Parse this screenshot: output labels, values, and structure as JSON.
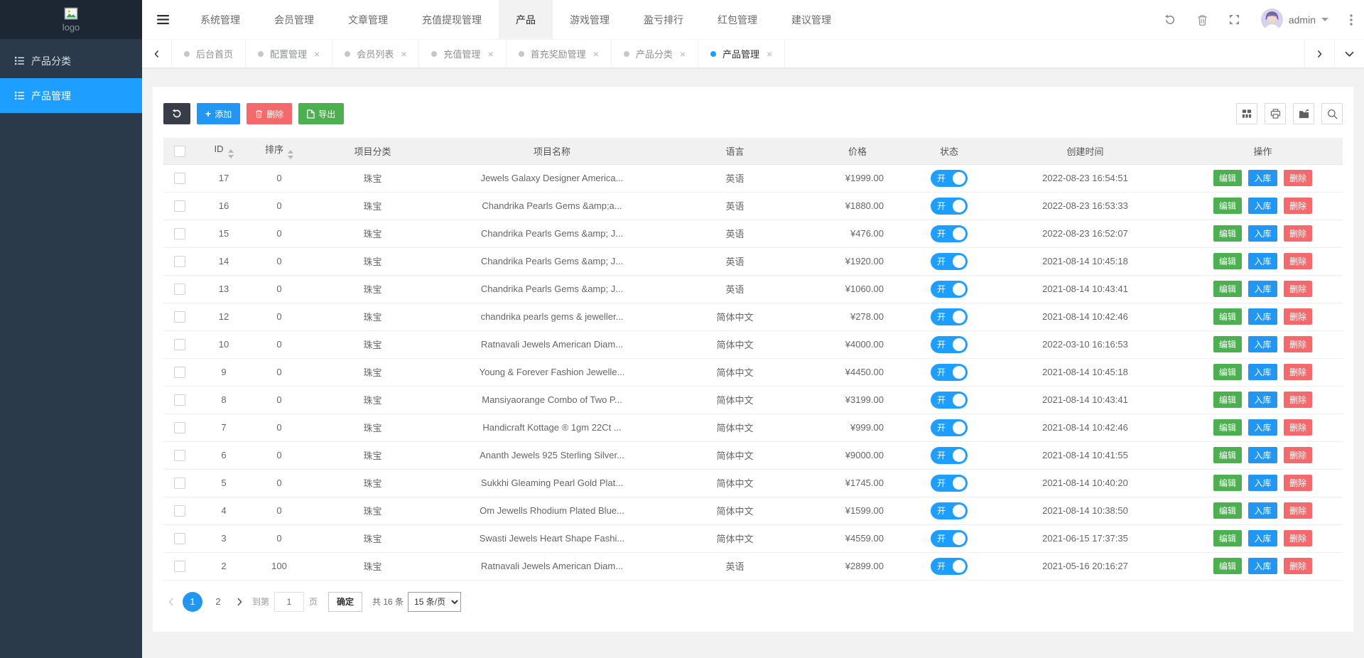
{
  "sidebar": {
    "logo_text": "logo",
    "items": [
      {
        "label": "产品分类",
        "active": false
      },
      {
        "label": "产品管理",
        "active": true
      }
    ]
  },
  "navbar": {
    "menu": [
      {
        "label": "系统管理",
        "active": false
      },
      {
        "label": "会员管理",
        "active": false
      },
      {
        "label": "文章管理",
        "active": false
      },
      {
        "label": "充值提现管理",
        "active": false
      },
      {
        "label": "产品",
        "active": true
      },
      {
        "label": "游戏管理",
        "active": false
      },
      {
        "label": "盈亏排行",
        "active": false
      },
      {
        "label": "红包管理",
        "active": false
      },
      {
        "label": "建议管理",
        "active": false
      }
    ],
    "username": "admin"
  },
  "tabs": [
    {
      "label": "后台首页",
      "closable": false,
      "active": false
    },
    {
      "label": "配置管理",
      "closable": true,
      "active": false
    },
    {
      "label": "会员列表",
      "closable": true,
      "active": false
    },
    {
      "label": "充值管理",
      "closable": true,
      "active": false
    },
    {
      "label": "首充奖励管理",
      "closable": true,
      "active": false
    },
    {
      "label": "产品分类",
      "closable": true,
      "active": false
    },
    {
      "label": "产品管理",
      "closable": true,
      "active": true
    }
  ],
  "toolbar": {
    "add_label": "添加",
    "delete_label": "删除",
    "export_label": "导出"
  },
  "table": {
    "columns": [
      "ID",
      "排序",
      "项目分类",
      "项目名称",
      "语言",
      "价格",
      "状态",
      "创建时间",
      "操作"
    ],
    "row_actions": [
      "编辑",
      "入库",
      "删除"
    ],
    "rows": [
      {
        "id": "17",
        "sort": "0",
        "category": "珠宝",
        "name": "Jewels Galaxy Designer America...",
        "language": "英语",
        "price": "¥1999.00",
        "status": "开",
        "created": "2022-08-23 16:54:51"
      },
      {
        "id": "16",
        "sort": "0",
        "category": "珠宝",
        "name": "Chandrika Pearls Gems &amp;a...",
        "language": "英语",
        "price": "¥1880.00",
        "status": "开",
        "created": "2022-08-23 16:53:33"
      },
      {
        "id": "15",
        "sort": "0",
        "category": "珠宝",
        "name": "Chandrika Pearls Gems &amp; J...",
        "language": "英语",
        "price": "¥476.00",
        "status": "开",
        "created": "2022-08-23 16:52:07"
      },
      {
        "id": "14",
        "sort": "0",
        "category": "珠宝",
        "name": "Chandrika Pearls Gems &amp; J...",
        "language": "英语",
        "price": "¥1920.00",
        "status": "开",
        "created": "2021-08-14 10:45:18"
      },
      {
        "id": "13",
        "sort": "0",
        "category": "珠宝",
        "name": "Chandrika Pearls Gems &amp; J...",
        "language": "英语",
        "price": "¥1060.00",
        "status": "开",
        "created": "2021-08-14 10:43:41"
      },
      {
        "id": "12",
        "sort": "0",
        "category": "珠宝",
        "name": "chandrika pearls gems & jeweller...",
        "language": "简体中文",
        "price": "¥278.00",
        "status": "开",
        "created": "2021-08-14 10:42:46"
      },
      {
        "id": "10",
        "sort": "0",
        "category": "珠宝",
        "name": "Ratnavali Jewels American Diam...",
        "language": "简体中文",
        "price": "¥4000.00",
        "status": "开",
        "created": "2022-03-10 16:16:53"
      },
      {
        "id": "9",
        "sort": "0",
        "category": "珠宝",
        "name": "Young & Forever Fashion Jewelle...",
        "language": "简体中文",
        "price": "¥4450.00",
        "status": "开",
        "created": "2021-08-14 10:45:18"
      },
      {
        "id": "8",
        "sort": "0",
        "category": "珠宝",
        "name": "Mansiyaorange Combo of Two P...",
        "language": "简体中文",
        "price": "¥3199.00",
        "status": "开",
        "created": "2021-08-14 10:43:41"
      },
      {
        "id": "7",
        "sort": "0",
        "category": "珠宝",
        "name": "Handicraft Kottage ® 1gm 22Ct ...",
        "language": "简体中文",
        "price": "¥999.00",
        "status": "开",
        "created": "2021-08-14 10:42:46"
      },
      {
        "id": "6",
        "sort": "0",
        "category": "珠宝",
        "name": "Ananth Jewels 925 Sterling Silver...",
        "language": "简体中文",
        "price": "¥9000.00",
        "status": "开",
        "created": "2021-08-14 10:41:55"
      },
      {
        "id": "5",
        "sort": "0",
        "category": "珠宝",
        "name": "Sukkhi Gleaming Pearl Gold Plat...",
        "language": "简体中文",
        "price": "¥1745.00",
        "status": "开",
        "created": "2021-08-14 10:40:20"
      },
      {
        "id": "4",
        "sort": "0",
        "category": "珠宝",
        "name": "Om Jewells Rhodium Plated Blue...",
        "language": "简体中文",
        "price": "¥1599.00",
        "status": "开",
        "created": "2021-08-14 10:38:50"
      },
      {
        "id": "3",
        "sort": "0",
        "category": "珠宝",
        "name": "Swasti Jewels Heart Shape Fashi...",
        "language": "简体中文",
        "price": "¥4559.00",
        "status": "开",
        "created": "2021-06-15 17:37:35"
      },
      {
        "id": "2",
        "sort": "100",
        "category": "珠宝",
        "name": "Ratnavali Jewels American Diam...",
        "language": "英语",
        "price": "¥2899.00",
        "status": "开",
        "created": "2021-05-16 20:16:27"
      }
    ]
  },
  "pagination": {
    "pages": [
      "1",
      "2"
    ],
    "current": "1",
    "goto_label": "到第",
    "goto_value": "1",
    "page_label": "页",
    "confirm_label": "确定",
    "total_label": "共 16 条",
    "page_size": "15 条/页"
  },
  "colors": {
    "accent_blue": "#2196f3",
    "sidebar_active_blue": "#1e9fff",
    "green": "#4caf50",
    "red": "#f4696b",
    "dark": "#393d49",
    "sidebar_bg": "#2b3a4a",
    "toggle_on": "#1e9fff"
  }
}
